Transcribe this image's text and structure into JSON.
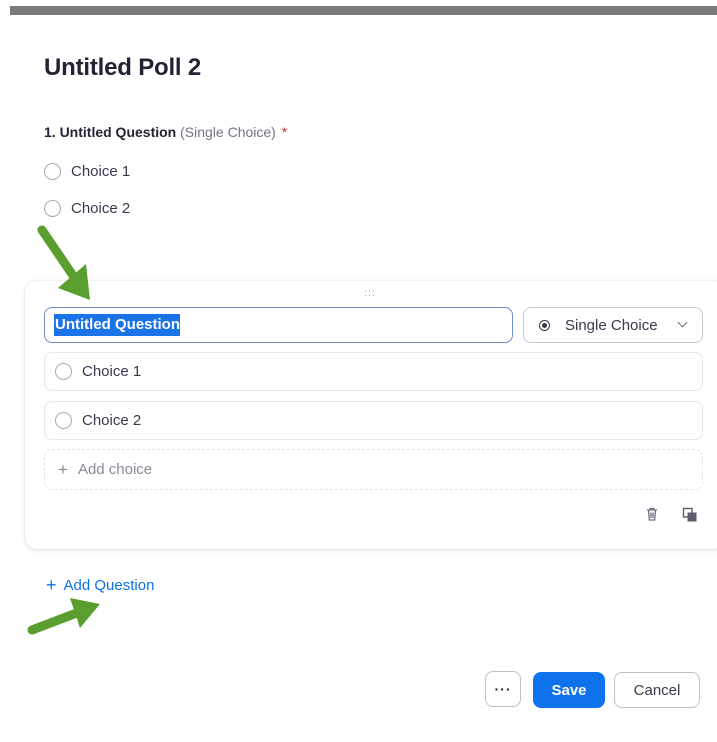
{
  "poll": {
    "title": "Untitled Poll 2"
  },
  "preview": {
    "question_name": "1. Untitled Question",
    "question_type": "(Single Choice)",
    "required_mark": "*",
    "choices": [
      "Choice 1",
      "Choice 2"
    ]
  },
  "editor": {
    "drag_handle": ":::",
    "question_value": "Untitled Question",
    "type_selected": "Single Choice",
    "choices": [
      "Choice 1",
      "Choice 2"
    ],
    "add_choice_label": "Add choice",
    "add_choice_icon": "+"
  },
  "add_question": {
    "icon": "+",
    "label": "Add Question"
  },
  "footer": {
    "more_label": "···",
    "save_label": "Save",
    "cancel_label": "Cancel"
  },
  "colors": {
    "accent": "#0e72ed",
    "selection": "#1a73e8",
    "required": "#e02828",
    "arrow": "#5a9e2f"
  },
  "icons": [
    "radio-icon",
    "radio-selected-icon",
    "chevron-down-icon",
    "plus-icon",
    "trash-icon",
    "duplicate-icon",
    "drag-handle-icon",
    "green-arrow-icon"
  ]
}
